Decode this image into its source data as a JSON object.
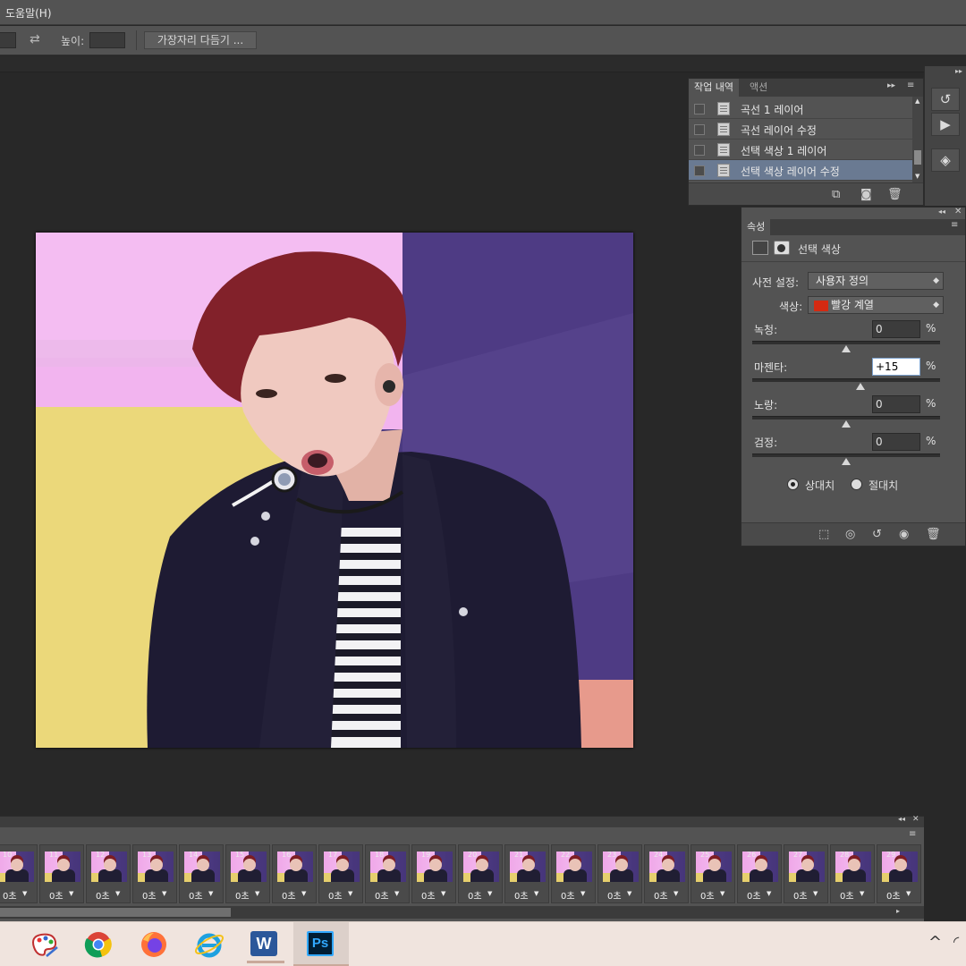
{
  "menubar": {
    "help_menu": "도움말(H)"
  },
  "options_bar": {
    "height_label": "높이:",
    "refine_edge_button": "가장자리 다듬기 ..."
  },
  "history_panel": {
    "tabs": [
      "작업 내역",
      "액션"
    ],
    "items": [
      "곡선 1 레이어",
      "곡선 레이어 수정",
      "선택 색상 1 레이어",
      "선택 색상 레이어 수정"
    ],
    "selected_index": 3
  },
  "properties_panel": {
    "tab": "속성",
    "adjustment_title": "선택 색상",
    "preset_label": "사전 설정:",
    "preset_value": "사용자 정의",
    "colors_label": "색상:",
    "colors_value": "빨강 계열",
    "colors_swatch": "#d42a12",
    "sliders": [
      {
        "label": "녹청:",
        "value": "0",
        "unit": "%",
        "level": 0
      },
      {
        "label": "마젠타:",
        "value": "+15",
        "unit": "%",
        "level": 15
      },
      {
        "label": "노랑:",
        "value": "0",
        "unit": "%",
        "level": 0
      },
      {
        "label": "검정:",
        "value": "0",
        "unit": "%",
        "level": 0
      }
    ],
    "method_relative": "상대치",
    "method_absolute": "절대치",
    "method_selected": "relative"
  },
  "timeline": {
    "frames": [
      {
        "number": "10",
        "delay": "0초"
      },
      {
        "number": "11",
        "delay": "0초"
      },
      {
        "number": "12",
        "delay": "0초"
      },
      {
        "number": "13",
        "delay": "0초"
      },
      {
        "number": "14",
        "delay": "0초"
      },
      {
        "number": "15",
        "delay": "0초"
      },
      {
        "number": "16",
        "delay": "0초"
      },
      {
        "number": "17",
        "delay": "0초"
      },
      {
        "number": "18",
        "delay": "0초"
      },
      {
        "number": "19",
        "delay": "0초"
      },
      {
        "number": "20",
        "delay": "0초"
      },
      {
        "number": "21",
        "delay": "0초"
      },
      {
        "number": "22",
        "delay": "0초"
      },
      {
        "number": "23",
        "delay": "0초"
      },
      {
        "number": "24",
        "delay": "0초"
      },
      {
        "number": "25",
        "delay": "0초"
      },
      {
        "number": "26",
        "delay": "0초"
      },
      {
        "number": "27",
        "delay": "0초"
      },
      {
        "number": "28",
        "delay": "0초"
      },
      {
        "number": "29",
        "delay": "0초"
      }
    ]
  },
  "taskbar": {
    "apps": [
      "paint-icon",
      "chrome-icon",
      "firefox-icon",
      "internet-explorer-icon",
      "word-icon",
      "photoshop-icon"
    ],
    "photoshop_label": "Ps",
    "word_label": "W"
  }
}
